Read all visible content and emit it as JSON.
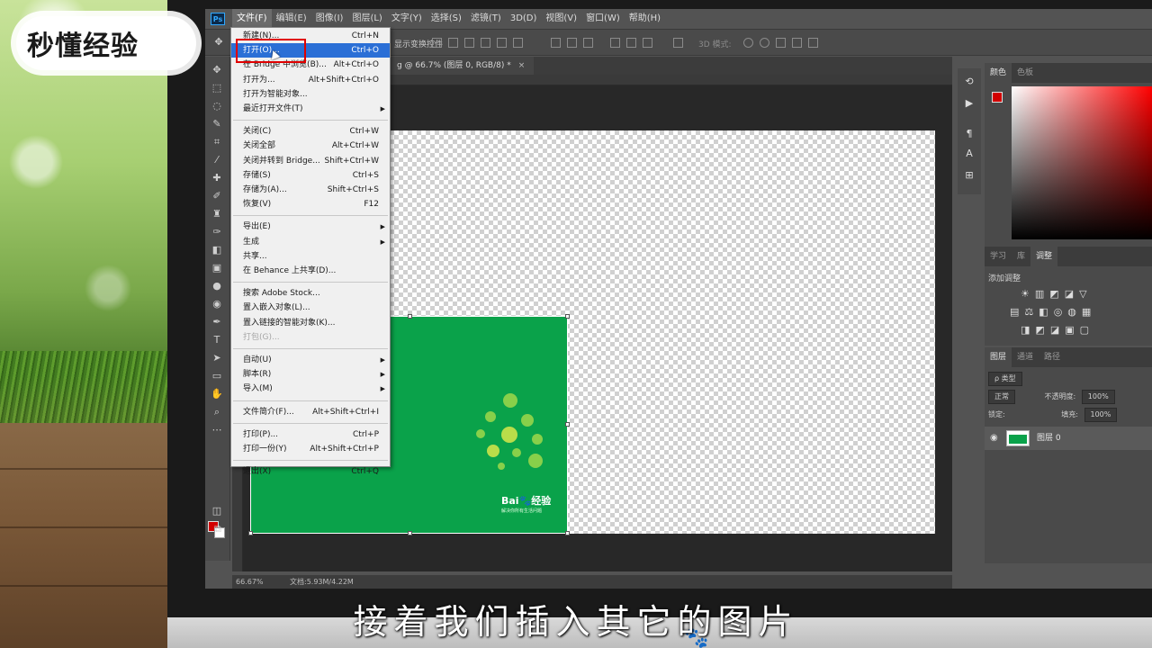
{
  "watermark": {
    "text": "秒懂经验"
  },
  "ps_logo": "Ps",
  "menubar": [
    "文件(F)",
    "编辑(E)",
    "图像(I)",
    "图层(L)",
    "文字(Y)",
    "选择(S)",
    "滤镜(T)",
    "3D(D)",
    "视图(V)",
    "窗口(W)",
    "帮助(H)"
  ],
  "optbar": {
    "label": "显示变换控件",
    "mode3d": "3D 模式:"
  },
  "doc_tab": {
    "title": "g @ 66.7% (图层 0, RGB/8) *",
    "close": "×"
  },
  "file_menu": {
    "items": [
      {
        "label": "新建(N)...",
        "shortcut": "Ctrl+N"
      },
      {
        "label": "打开(O)...",
        "shortcut": "Ctrl+O",
        "highlighted": true
      },
      {
        "label": "在 Bridge 中浏览(B)...",
        "shortcut": "Alt+Ctrl+O"
      },
      {
        "label": "打开为...",
        "shortcut": "Alt+Shift+Ctrl+O"
      },
      {
        "label": "打开为智能对象..."
      },
      {
        "label": "最近打开文件(T)",
        "submenu": true
      },
      {
        "label": "关闭(C)",
        "shortcut": "Ctrl+W"
      },
      {
        "label": "关闭全部",
        "shortcut": "Alt+Ctrl+W"
      },
      {
        "label": "关闭并转到 Bridge...",
        "shortcut": "Shift+Ctrl+W"
      },
      {
        "label": "存储(S)",
        "shortcut": "Ctrl+S"
      },
      {
        "label": "存储为(A)...",
        "shortcut": "Shift+Ctrl+S"
      },
      {
        "label": "恢复(V)",
        "shortcut": "F12"
      },
      {
        "label": "导出(E)",
        "submenu": true
      },
      {
        "label": "生成",
        "submenu": true
      },
      {
        "label": "共享..."
      },
      {
        "label": "在 Behance 上共享(D)..."
      },
      {
        "label": "搜索 Adobe Stock..."
      },
      {
        "label": "置入嵌入对象(L)..."
      },
      {
        "label": "置入链接的智能对象(K)..."
      },
      {
        "label": "打包(G)...",
        "disabled": true
      },
      {
        "label": "自动(U)",
        "submenu": true
      },
      {
        "label": "脚本(R)",
        "submenu": true
      },
      {
        "label": "导入(M)",
        "submenu": true
      },
      {
        "label": "文件简介(F)...",
        "shortcut": "Alt+Shift+Ctrl+I"
      },
      {
        "label": "打印(P)...",
        "shortcut": "Ctrl+P"
      },
      {
        "label": "打印一份(Y)",
        "shortcut": "Alt+Shift+Ctrl+P"
      },
      {
        "label": "退出(X)",
        "shortcut": "Ctrl+Q"
      }
    ]
  },
  "canvas_image": {
    "brand": "Bai🐾经验",
    "tagline": "解决你所有生活问题"
  },
  "statusbar": {
    "zoom": "66.67%",
    "doc": "文档:5.93M/4.22M"
  },
  "color_panel": {
    "tabs": [
      "颜色",
      "色板"
    ],
    "fg_color": "#d20000"
  },
  "adjust_panel": {
    "tabs": [
      "学习",
      "库",
      "调整"
    ],
    "title": "添加调整"
  },
  "layers_panel": {
    "tabs": [
      "图层",
      "通道",
      "路径"
    ],
    "filter": "ρ 类型",
    "blend_mode": "正常",
    "opacity_label": "不透明度:",
    "opacity": "100%",
    "lock_label": "锁定:",
    "fill_label": "填充:",
    "fill": "100%",
    "layer_name": "图层 0"
  },
  "subtitle": "接着我们插入其它的图片"
}
